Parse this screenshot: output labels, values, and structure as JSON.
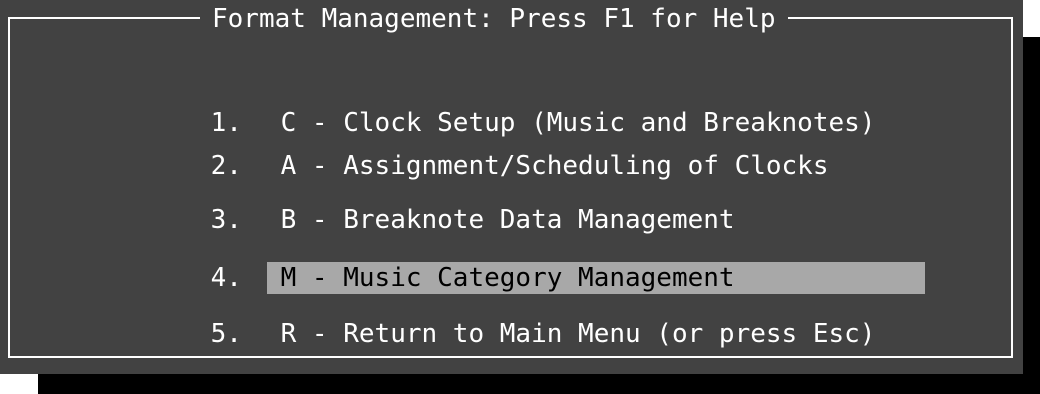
{
  "window": {
    "title": "Format Management: Press F1 for Help"
  },
  "menu": {
    "items": [
      {
        "number": "1.",
        "label": "C - Clock Setup (Music and Breaknotes)"
      },
      {
        "number": "2.",
        "label": "A - Assignment/Scheduling of Clocks"
      },
      {
        "number": "3.",
        "label": "B - Breaknote Data Management"
      },
      {
        "number": "4.",
        "label": "M - Music Category Management",
        "selected": true
      },
      {
        "number": "5.",
        "label": "R - Return to Main Menu (or press Esc)"
      }
    ]
  },
  "colors": {
    "window_bg": "#424242",
    "border": "#ffffff",
    "text": "#ffffff",
    "highlight_bg": "#a8a8a8",
    "highlight_text": "#000000",
    "shadow": "#000000"
  }
}
